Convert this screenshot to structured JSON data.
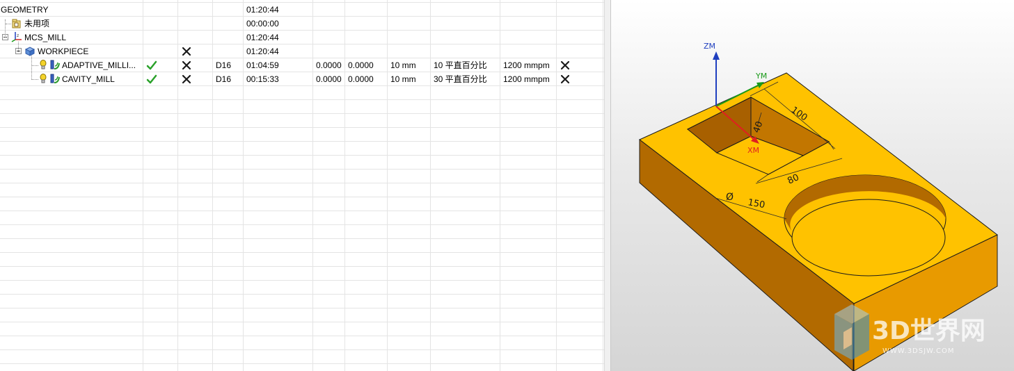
{
  "operation_navigator": {
    "rows": [
      {
        "name": "GEOMETRY",
        "status": "",
        "regen": "",
        "tool": "",
        "time": "01:20:44",
        "stock_wall": "",
        "stock_floor": "",
        "step": "",
        "stepover": "",
        "feed": "",
        "extra": ""
      },
      {
        "name": "未用项",
        "status": "",
        "regen": "",
        "tool": "",
        "time": "00:00:00",
        "stock_wall": "",
        "stock_floor": "",
        "step": "",
        "stepover": "",
        "feed": "",
        "extra": ""
      },
      {
        "name": "MCS_MILL",
        "status": "",
        "regen": "",
        "tool": "",
        "time": "01:20:44",
        "stock_wall": "",
        "stock_floor": "",
        "step": "",
        "stepover": "",
        "feed": "",
        "extra": ""
      },
      {
        "name": "WORKPIECE",
        "status": "",
        "regen": "cross",
        "tool": "",
        "time": "01:20:44",
        "stock_wall": "",
        "stock_floor": "",
        "step": "",
        "stepover": "",
        "feed": "",
        "extra": ""
      },
      {
        "name": "ADAPTIVE_MILLI...",
        "status": "check",
        "regen": "cross",
        "tool": "D16",
        "time": "01:04:59",
        "stock_wall": "0.0000",
        "stock_floor": "0.0000",
        "step": "10 mm",
        "stepover": "10 平直百分比",
        "feed": "1200 mmpm",
        "extra": "cross"
      },
      {
        "name": "CAVITY_MILL",
        "status": "check",
        "regen": "cross",
        "tool": "D16",
        "time": "00:15:33",
        "stock_wall": "0.0000",
        "stock_floor": "0.0000",
        "step": "10 mm",
        "stepover": "30 平直百分比",
        "feed": "1200 mmpm",
        "extra": "cross"
      }
    ]
  },
  "viewport": {
    "axes": {
      "z": "ZM",
      "y": "YM",
      "x": "XM"
    },
    "dimensions": {
      "pocket_length": "100",
      "pocket_depth": "40",
      "pocket_width": "80",
      "hole_diameter": "150",
      "diameter_symbol": "Ø"
    },
    "part_color": "#FFC200",
    "watermark": {
      "brand": "3D世界网",
      "url": "WWW.3DSJW.COM"
    }
  },
  "colors": {
    "check": "#2aa12a",
    "z_axis": "#1f3fbf",
    "y_axis": "#1a9a1a",
    "x_axis": "#e02020"
  }
}
